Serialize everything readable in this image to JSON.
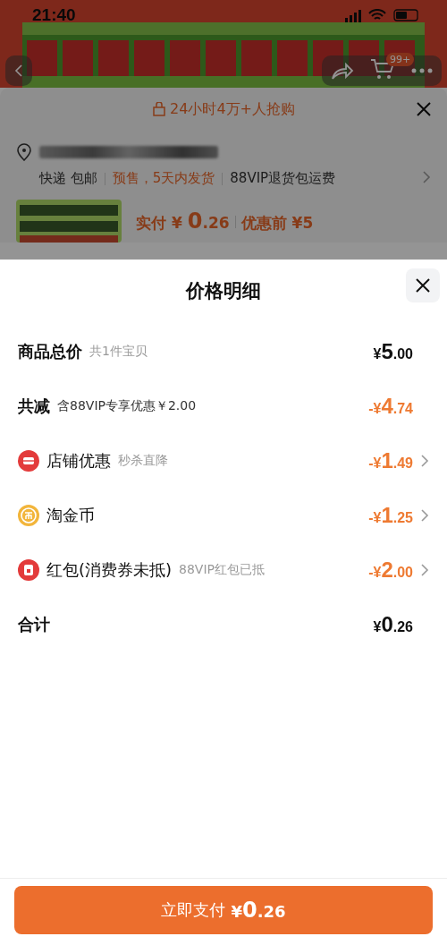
{
  "status_bar": {
    "time": "21:40"
  },
  "product_header": {
    "cart_badge": "99+"
  },
  "order_sheet": {
    "promo": "24小时4万+人抢购",
    "shipping": [
      {
        "text": "快递 包邮",
        "kind": "plain"
      },
      {
        "text": "预售，5天内发货",
        "kind": "accent"
      },
      {
        "text": "88VIP退货包运费",
        "kind": "plain"
      }
    ],
    "pay_label": "实付",
    "pay_price": "¥ 0.26",
    "original_label": "优惠前",
    "original_price": "¥5"
  },
  "price_detail": {
    "title": "价格明细",
    "rows": [
      {
        "kind": "total",
        "label": "商品总价",
        "note": "共1件宝贝",
        "amount": "¥5.00"
      },
      {
        "kind": "savings",
        "label": "共减",
        "note": "含88VIP专享优惠￥2.00",
        "amount": "-¥4.74"
      },
      {
        "kind": "shop",
        "label": "店铺优惠",
        "note": "秒杀直降",
        "amount": "-¥1.49"
      },
      {
        "kind": "coin",
        "label": "淘金币",
        "amount": "-¥1.25"
      },
      {
        "kind": "packet",
        "label": "红包(消费券未抵)",
        "note": "88VIP红包已抵",
        "amount": "-¥2.00"
      },
      {
        "kind": "total",
        "label": "合计",
        "amount": "¥0.26"
      }
    ]
  },
  "pay_button": {
    "label": "立即支付",
    "amount": "¥0.26"
  }
}
